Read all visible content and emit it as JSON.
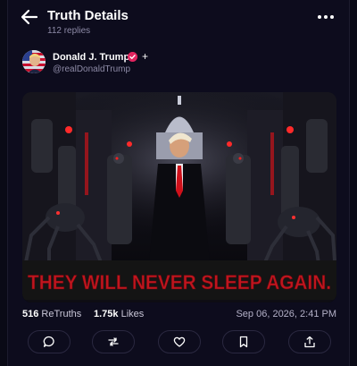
{
  "header": {
    "title": "Truth Details",
    "subtitle": "112 replies"
  },
  "post": {
    "author_name": "Donald J. Trump",
    "author_handle": "@realDonaldTrump",
    "plus_badge": "+",
    "image_caption": "THEY WILL NEVER SLEEP AGAIN.",
    "retruths_count": "516",
    "retruths_label": "ReTruths",
    "likes_count": "1.75k",
    "likes_label": "Likes",
    "timestamp": "Sep 06, 2026, 2:41 PM"
  },
  "actions": [
    {
      "icon": "reply-icon"
    },
    {
      "icon": "retruth-icon"
    },
    {
      "icon": "like-heart-icon"
    },
    {
      "icon": "bookmark-icon"
    },
    {
      "icon": "share-icon"
    }
  ],
  "colors": {
    "background": "#0d0c1d",
    "verified": "#e0245e",
    "caption_red": "#c0151e",
    "muted_text": "#8d8aa6"
  }
}
